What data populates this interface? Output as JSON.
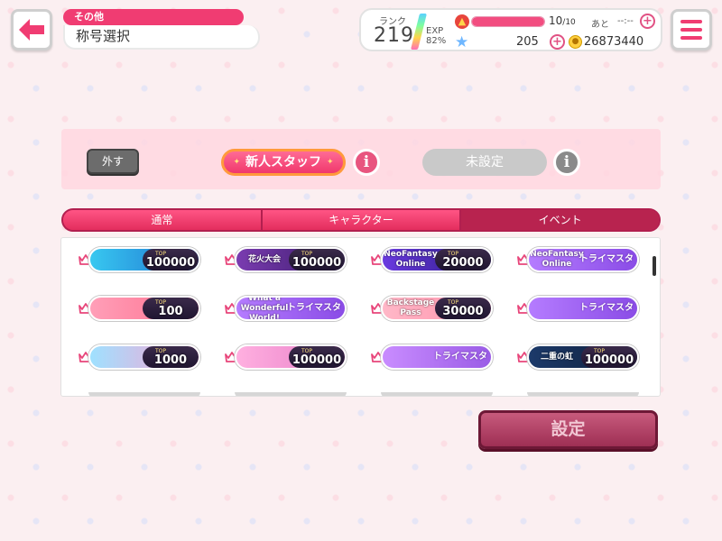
{
  "header": {
    "category_tag": "その他",
    "page_title": "称号選択",
    "back_icon": "arrow-left-icon",
    "menu_icon": "hamburger-icon"
  },
  "status": {
    "rank_label": "ランク",
    "rank_value": "219",
    "exp_label": "EXP",
    "exp_percent_text": "82%",
    "stamina_current": "10",
    "stamina_max": "/10",
    "stamina_fraction": 1.0,
    "stamina_ato": "あと",
    "stamina_timer": "--:--",
    "stars": "205",
    "coins": "26873440"
  },
  "equipped": {
    "remove_label": "外す",
    "equipped_title": "新人スタッフ",
    "unset_label": "未設定"
  },
  "tabs": [
    {
      "label": "通常",
      "active": false
    },
    {
      "label": "キャラクター",
      "active": false
    },
    {
      "label": "イベント",
      "active": true
    }
  ],
  "top_label": "TOP",
  "titles": [
    [
      {
        "art": "",
        "kind": "rank",
        "rank": "100000",
        "colors": [
          "#38c8f0",
          "#1e6fd0"
        ]
      },
      {
        "art": "花火大会",
        "kind": "rank",
        "rank": "100000",
        "colors": [
          "#7a3cb0",
          "#3a1a6a"
        ]
      },
      {
        "art": "NeoFantasy Online",
        "kind": "rank",
        "rank": "20000",
        "colors": [
          "#6a3ae0",
          "#2a1a80"
        ]
      },
      {
        "art": "NeoFantasy Online",
        "kind": "try",
        "try_label": "トライマスター",
        "colors": [
          "#b57cff",
          "#8a4ce6"
        ]
      }
    ],
    [
      {
        "art": "",
        "kind": "rank",
        "rank": "100",
        "colors": [
          "#ff9fb8",
          "#ff6f8e"
        ]
      },
      {
        "art": "What a Wonderful World!",
        "kind": "try",
        "try_label": "トライマスター",
        "colors": [
          "#b57cff",
          "#8a4ce6"
        ]
      },
      {
        "art": "Backstage Pass",
        "kind": "rank",
        "rank": "30000",
        "colors": [
          "#ffb8c8",
          "#ff8fa9"
        ]
      },
      {
        "art": "",
        "kind": "try",
        "try_label": "トライマスター",
        "colors": [
          "#b57cff",
          "#8a4ce6"
        ]
      }
    ],
    [
      {
        "art": "",
        "kind": "rank",
        "rank": "1000",
        "colors": [
          "#9fe1ff",
          "#ff9fd0"
        ]
      },
      {
        "art": "",
        "kind": "rank",
        "rank": "100000",
        "colors": [
          "#ffb0e0",
          "#e77cc7"
        ]
      },
      {
        "art": "",
        "kind": "try",
        "try_label": "トライマスター",
        "colors": [
          "#c98cff",
          "#9a5ce6"
        ]
      },
      {
        "art": "二重の虹",
        "kind": "rank",
        "rank": "100000",
        "colors": [
          "#1c3a6a",
          "#0f1e3a"
        ]
      }
    ]
  ],
  "settings_label": "設定"
}
